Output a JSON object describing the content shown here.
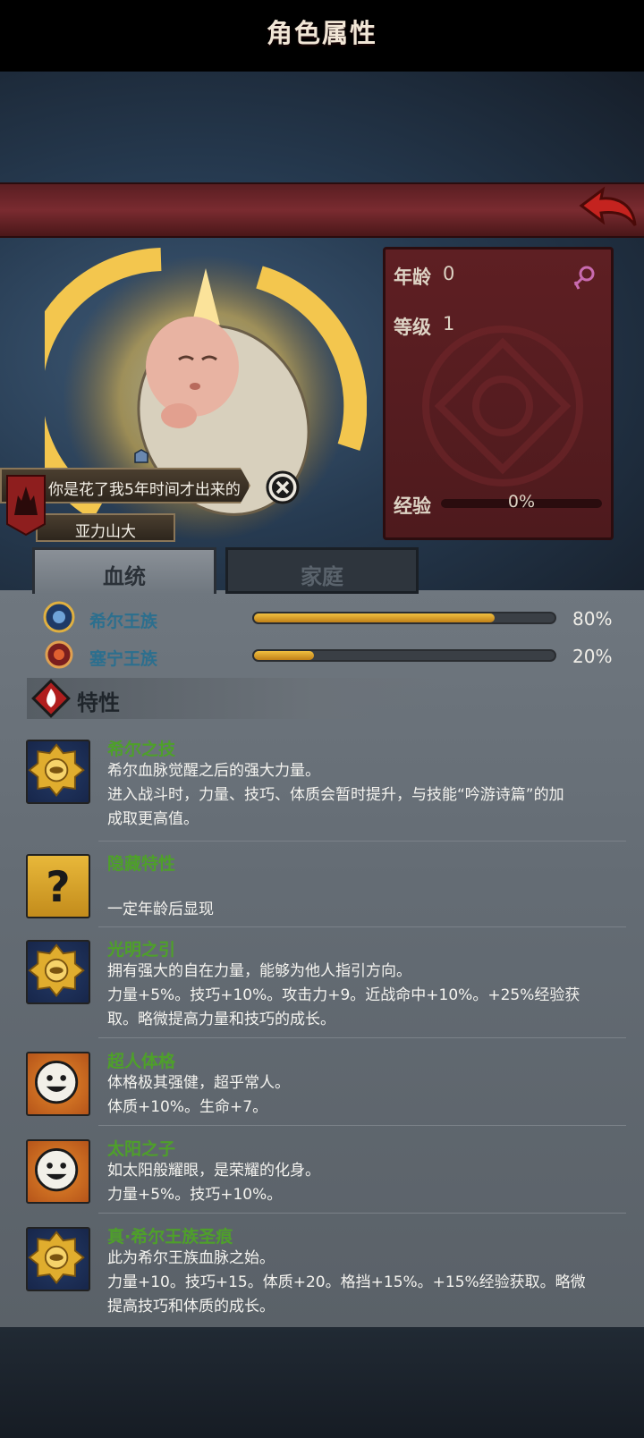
{
  "header": {
    "title": "角色属性"
  },
  "character": {
    "quote": "你是花了我5年时间才出来的",
    "name": "亚力山大"
  },
  "stats": {
    "age_label": "年龄",
    "age_value": "0",
    "level_label": "等级",
    "level_value": "1",
    "exp_label": "经验",
    "exp_value": "0%",
    "exp_fraction": 0
  },
  "tabs": [
    {
      "label": "血统",
      "active": true
    },
    {
      "label": "家庭",
      "active": false
    }
  ],
  "bloodlines": [
    {
      "name": "希尔王族",
      "percent": "80%",
      "fraction": 0.8
    },
    {
      "name": "塞宁王族",
      "percent": "20%",
      "fraction": 0.2
    }
  ],
  "traits_section": {
    "title": "特性"
  },
  "traits": [
    {
      "name": "希尔之技",
      "icon": "golden-sun-medallion-icon",
      "lines": [
        "希尔血脉觉醒之后的强大力量。",
        "进入战斗时，力量、技巧、体质会暂时提升，与技能“吟游诗篇”的加",
        "成取更高值。"
      ]
    },
    {
      "name": "隐藏特性",
      "icon": "question-mark-icon",
      "lines": [
        "",
        "一定年龄后显现"
      ]
    },
    {
      "name": "光明之引",
      "icon": "golden-sun-medallion-icon",
      "lines": [
        "拥有强大的自在力量，能够为他人指引方向。",
        "力量+5%。技巧+10%。攻击力+9。近战命中+10%。+25%经验获",
        "取。略微提高力量和技巧的成长。"
      ]
    },
    {
      "name": "超人体格",
      "icon": "smiley-face-icon",
      "lines": [
        "体格极其强健，超乎常人。",
        "体质+10%。生命+7。"
      ]
    },
    {
      "name": "太阳之子",
      "icon": "smiley-face-icon",
      "lines": [
        "如太阳般耀眼，是荣耀的化身。",
        "力量+5%。技巧+10%。"
      ]
    },
    {
      "name": "真·希尔王族圣痕",
      "icon": "golden-sun-medallion-icon",
      "lines": [
        "此为希尔王族血脉之始。",
        "力量+10。技巧+15。体质+20。格挡+15%。+15%经验获取。略微",
        "提高技巧和体质的成长。"
      ]
    }
  ],
  "colors": {
    "banner": "#7a2b30",
    "trait_name": "#4ea02a",
    "bloodline_name": "#2c6f8e",
    "bar_fill": "#f0c040"
  }
}
